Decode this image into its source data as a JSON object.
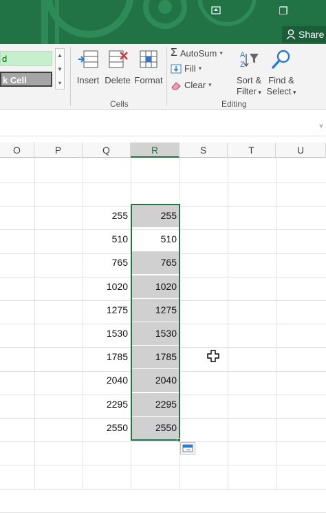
{
  "window": {
    "restore_label": "❐",
    "share_label": "Share"
  },
  "ribbon": {
    "styles": {
      "good_label": "d",
      "check_cell_label": "k Cell"
    },
    "cells": {
      "insert_label": "Insert",
      "delete_label": "Delete",
      "format_label": "Format",
      "group_label": "Cells"
    },
    "editing": {
      "autosum_label": "AutoSum",
      "fill_label": "Fill",
      "clear_label": "Clear",
      "sort_filter_line1": "Sort &",
      "sort_filter_line2": "Filter",
      "find_select_line1": "Find &",
      "find_select_line2": "Select",
      "group_label": "Editing"
    }
  },
  "columns": [
    "O",
    "P",
    "Q",
    "R",
    "S",
    "T",
    "U"
  ],
  "selected_column": "R",
  "rows": [
    {
      "q": "255",
      "r": "255",
      "highlighted": true
    },
    {
      "q": "510",
      "r": "510",
      "highlighted": false
    },
    {
      "q": "765",
      "r": "765",
      "highlighted": true
    },
    {
      "q": "1020",
      "r": "1020",
      "highlighted": true
    },
    {
      "q": "1275",
      "r": "1275",
      "highlighted": true
    },
    {
      "q": "1530",
      "r": "1530",
      "highlighted": true
    },
    {
      "q": "1785",
      "r": "1785",
      "highlighted": true
    },
    {
      "q": "2040",
      "r": "2040",
      "highlighted": true
    },
    {
      "q": "2295",
      "r": "2295",
      "highlighted": true
    },
    {
      "q": "2550",
      "r": "2550",
      "highlighted": true
    }
  ],
  "colors": {
    "accent": "#217346",
    "selection_fill": "#d0d0d0",
    "good_style_bg": "#c6efce",
    "check_cell_bg": "#a5a5a5"
  },
  "icons": {
    "restore": "restore-window-icon",
    "share": "person-icon",
    "insert": "insert-cells-icon",
    "delete": "delete-cells-icon",
    "format": "format-cells-icon",
    "autosum": "sigma-icon",
    "fill": "fill-down-icon",
    "clear": "eraser-icon",
    "sort_filter": "sort-filter-icon",
    "find_select": "magnifier-icon",
    "quick_analysis": "quick-analysis-icon",
    "cursor": "cross-cursor-icon"
  }
}
